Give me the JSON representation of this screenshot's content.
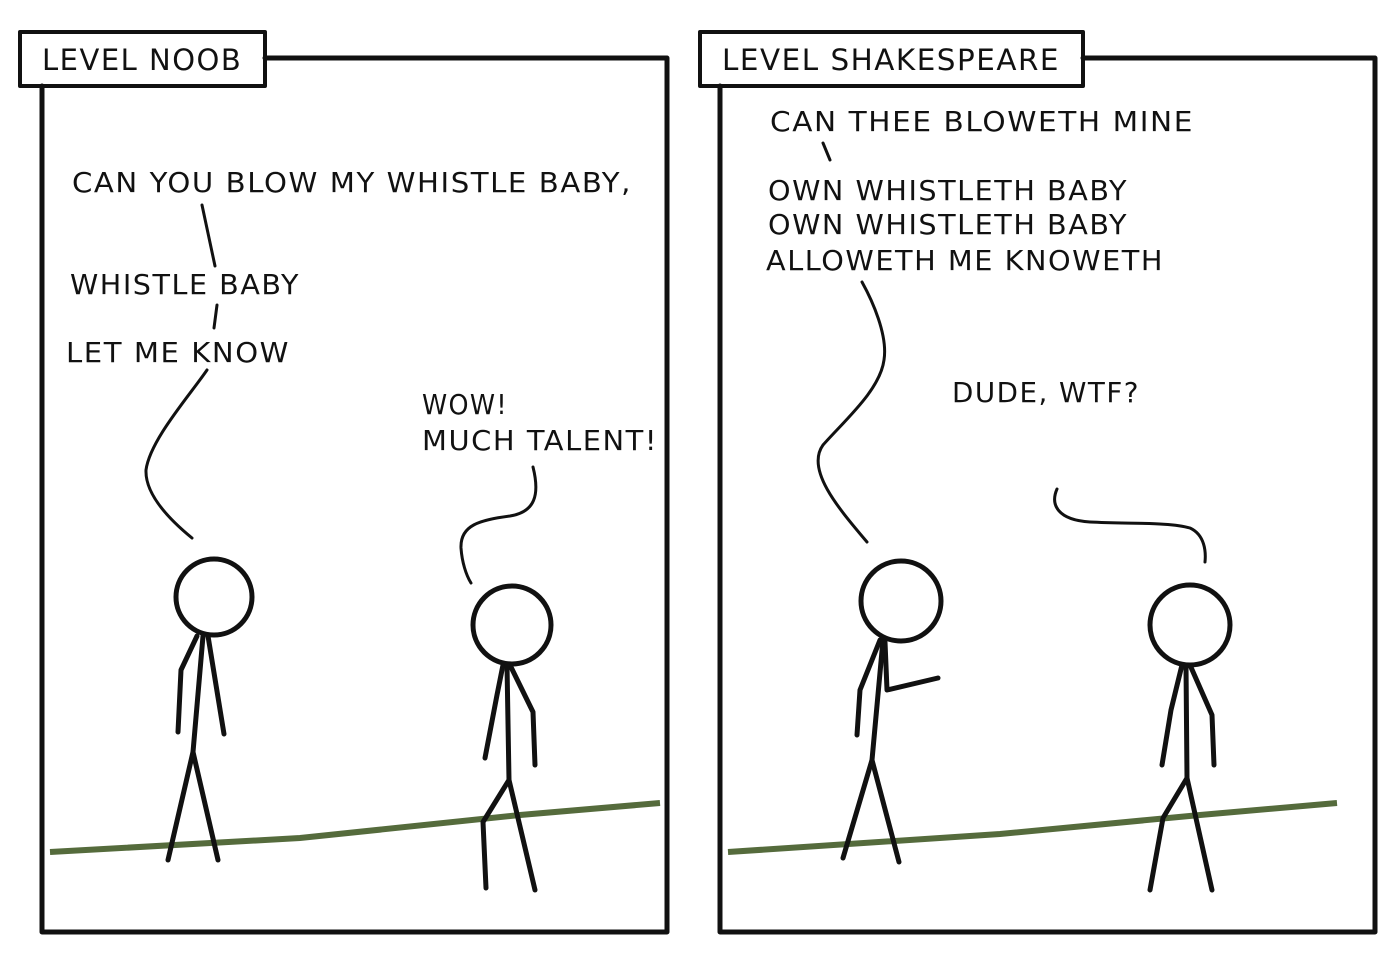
{
  "colors": {
    "ink": "#111111",
    "ground": "#556b3c",
    "paper": "#ffffff"
  },
  "panels": [
    {
      "caption": "LEVEL NOOB",
      "speaker_lines": [
        "CAN YOU BLOW MY WHISTLE BABY,",
        "WHISTLE BABY",
        "LET ME KNOW"
      ],
      "listener_lines": [
        "WOW!",
        "MUCH TALENT!"
      ]
    },
    {
      "caption": "LEVEL SHAKESPEARE",
      "speaker_lines": [
        "CAN THEE BLOWETH MINE",
        "OWN WHISTLETH BABY",
        "OWN WHISTLETH BABY",
        "ALLOWETH ME KNOWETH"
      ],
      "listener_lines": [
        "DUDE, WTF?"
      ]
    }
  ]
}
